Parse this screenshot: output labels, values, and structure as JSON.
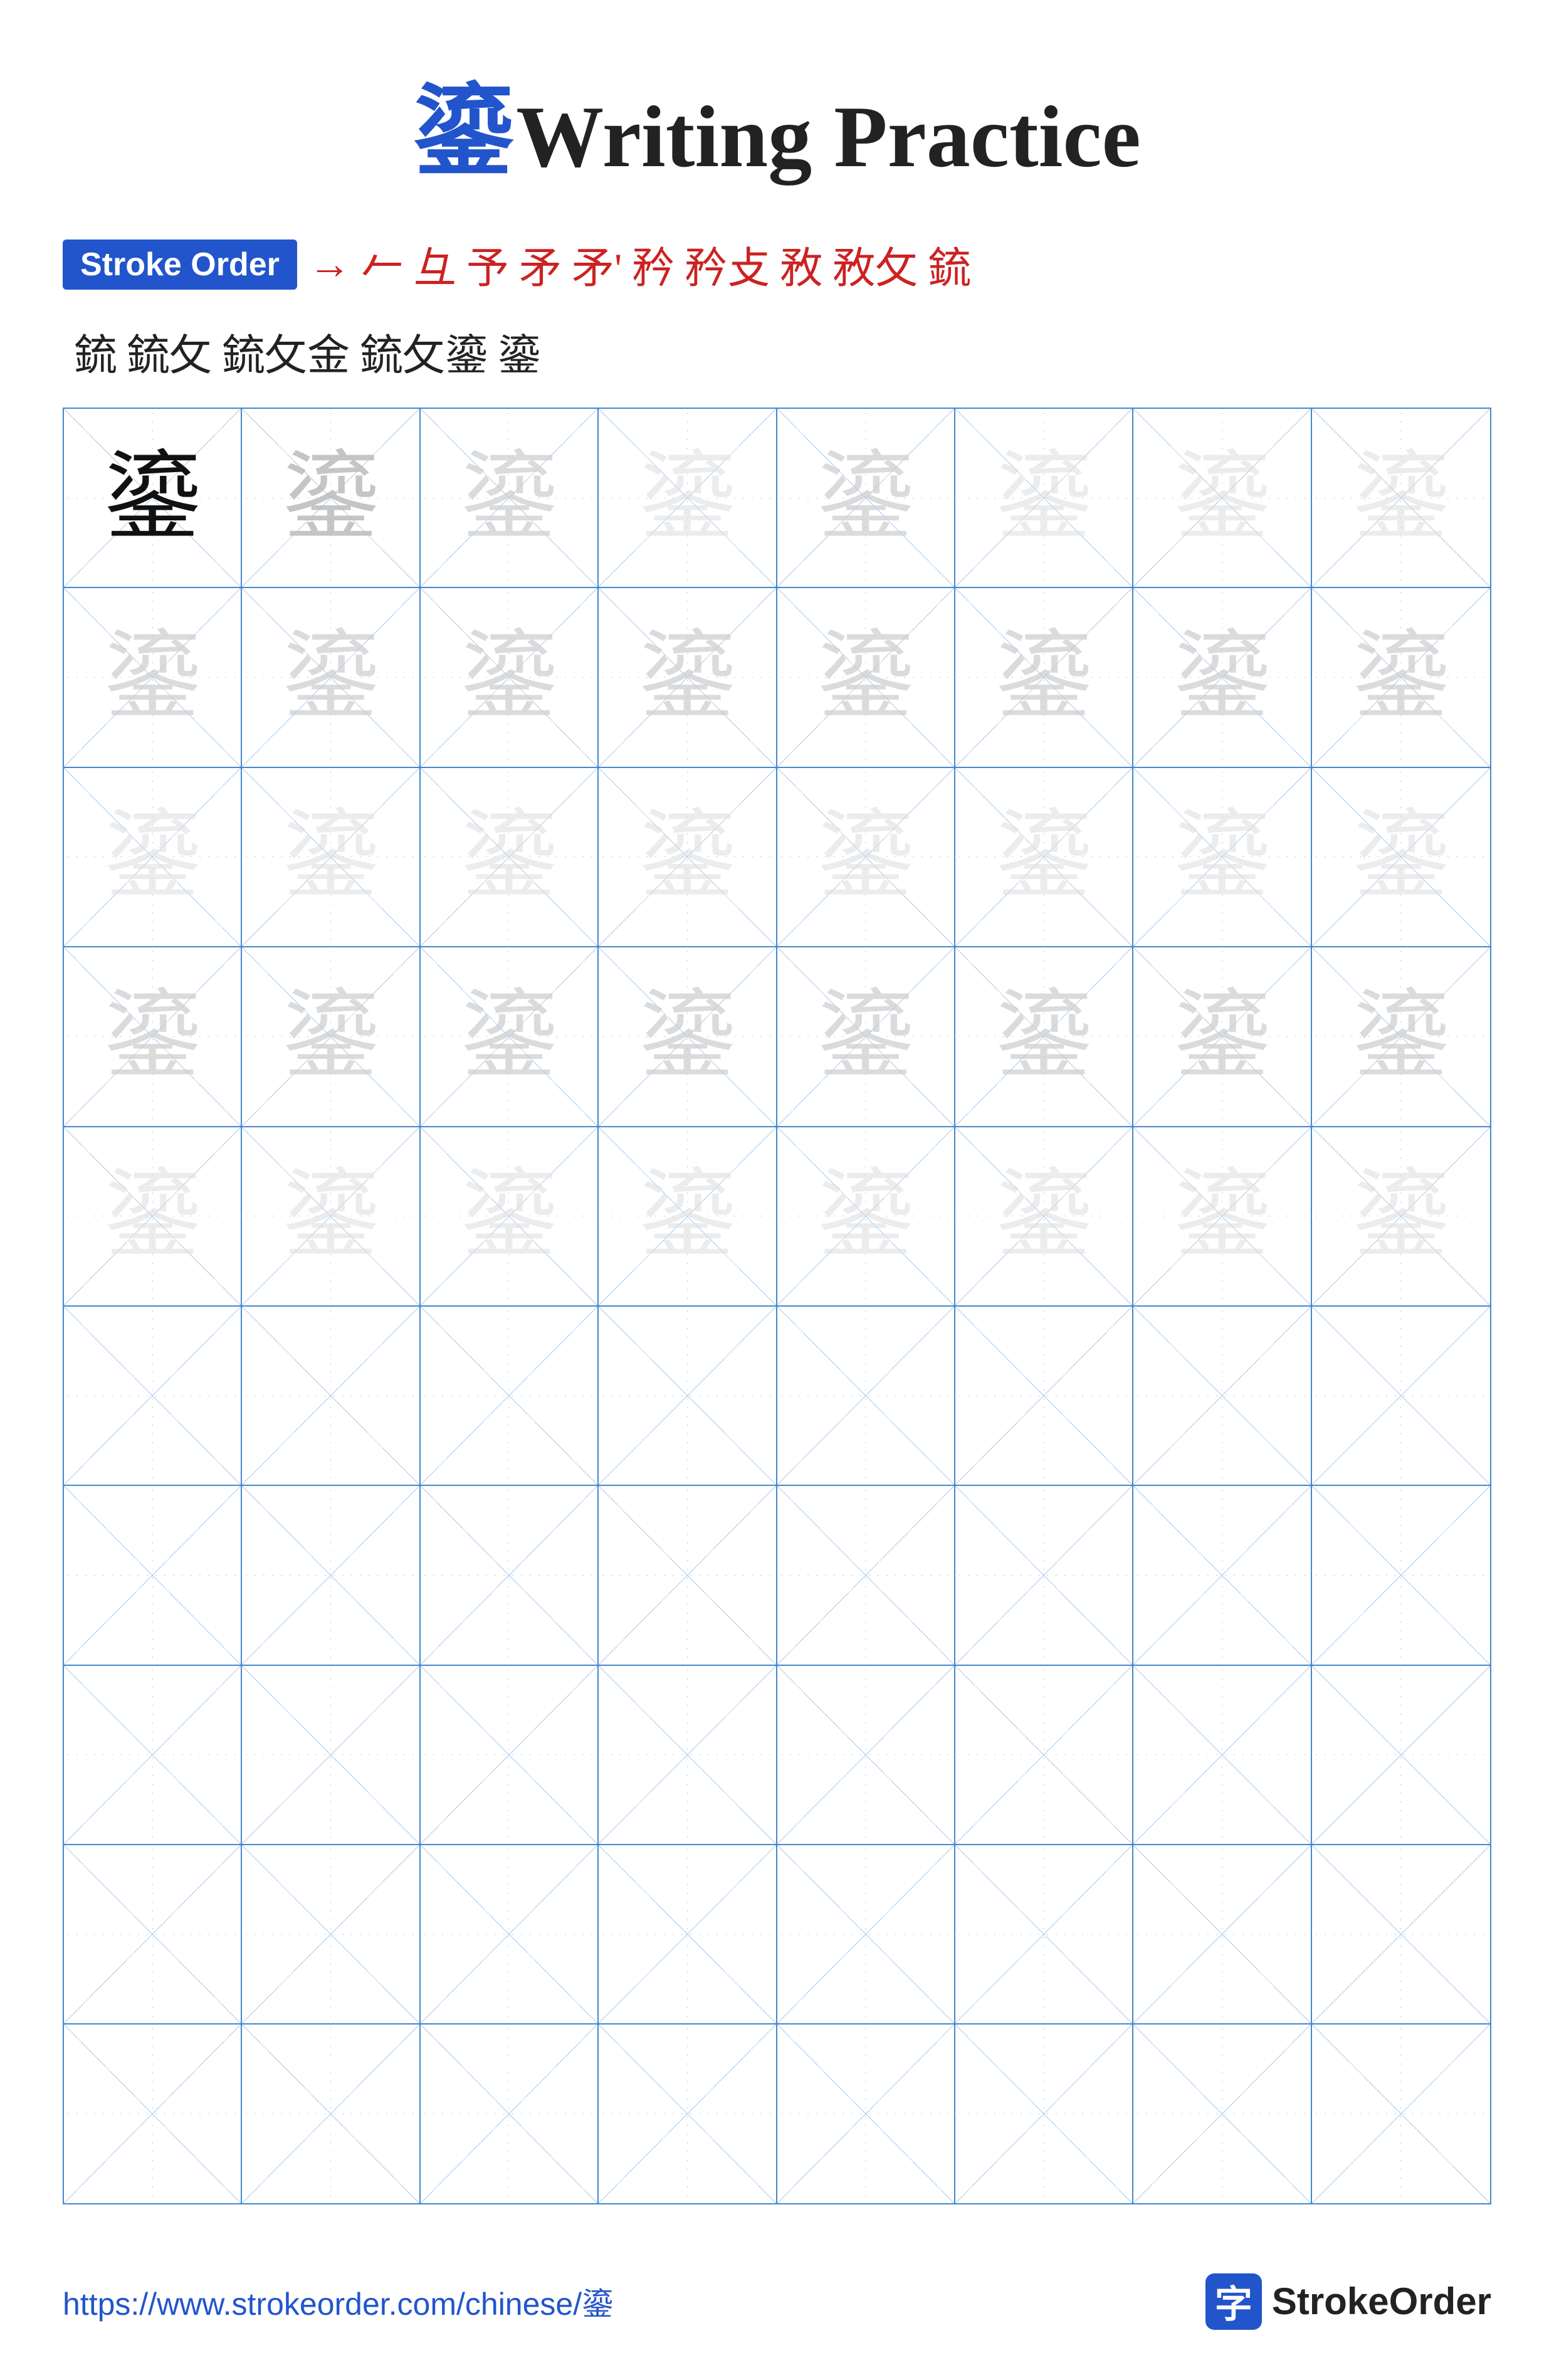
{
  "title": {
    "chinese": "鎏",
    "english": "Writing Practice"
  },
  "stroke_order": {
    "badge_label": "Stroke Order",
    "chars_red": [
      "→",
      "𠂉",
      "彑",
      "予",
      "矛",
      "矛'",
      "矜",
      "矜攴",
      "敄",
      "敄攵",
      "鋶"
    ],
    "chars_black_row2": [
      "鋶",
      "鋶攵",
      "鋶攵金",
      "鋶攵鎏",
      "鎏"
    ]
  },
  "main_char": "鎏",
  "grid": {
    "rows": 10,
    "cols": 8,
    "char": "鎏",
    "practice_rows": 5,
    "empty_rows": 5
  },
  "footer": {
    "url": "https://www.strokeorder.com/chinese/鎏",
    "logo_icon": "字",
    "logo_text": "StrokeOrder"
  }
}
